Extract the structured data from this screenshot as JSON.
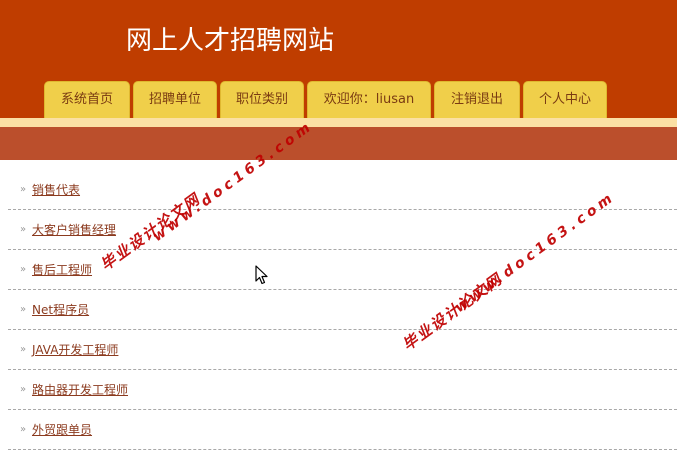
{
  "header": {
    "title": "网上人才招聘网站"
  },
  "nav": {
    "tabs": [
      {
        "label": "系统首页"
      },
      {
        "label": "招聘单位"
      },
      {
        "label": "职位类别"
      },
      {
        "label": "欢迎你：liusan"
      },
      {
        "label": "注销退出"
      },
      {
        "label": "个人中心"
      }
    ]
  },
  "jobs": [
    {
      "label": "销售代表"
    },
    {
      "label": "大客户销售经理"
    },
    {
      "label": "售后工程师"
    },
    {
      "label": "Net程序员"
    },
    {
      "label": "JAVA开发工程师"
    },
    {
      "label": "路由器开发工程师"
    },
    {
      "label": "外贸跟单员"
    }
  ],
  "watermark": {
    "cn": "毕业设计论文网",
    "url": "www.doc163.com"
  },
  "colors": {
    "header": "#bf3d00",
    "tab": "#f0cf4a",
    "bar": "#bb4f2c",
    "link": "#8b3a1e"
  }
}
